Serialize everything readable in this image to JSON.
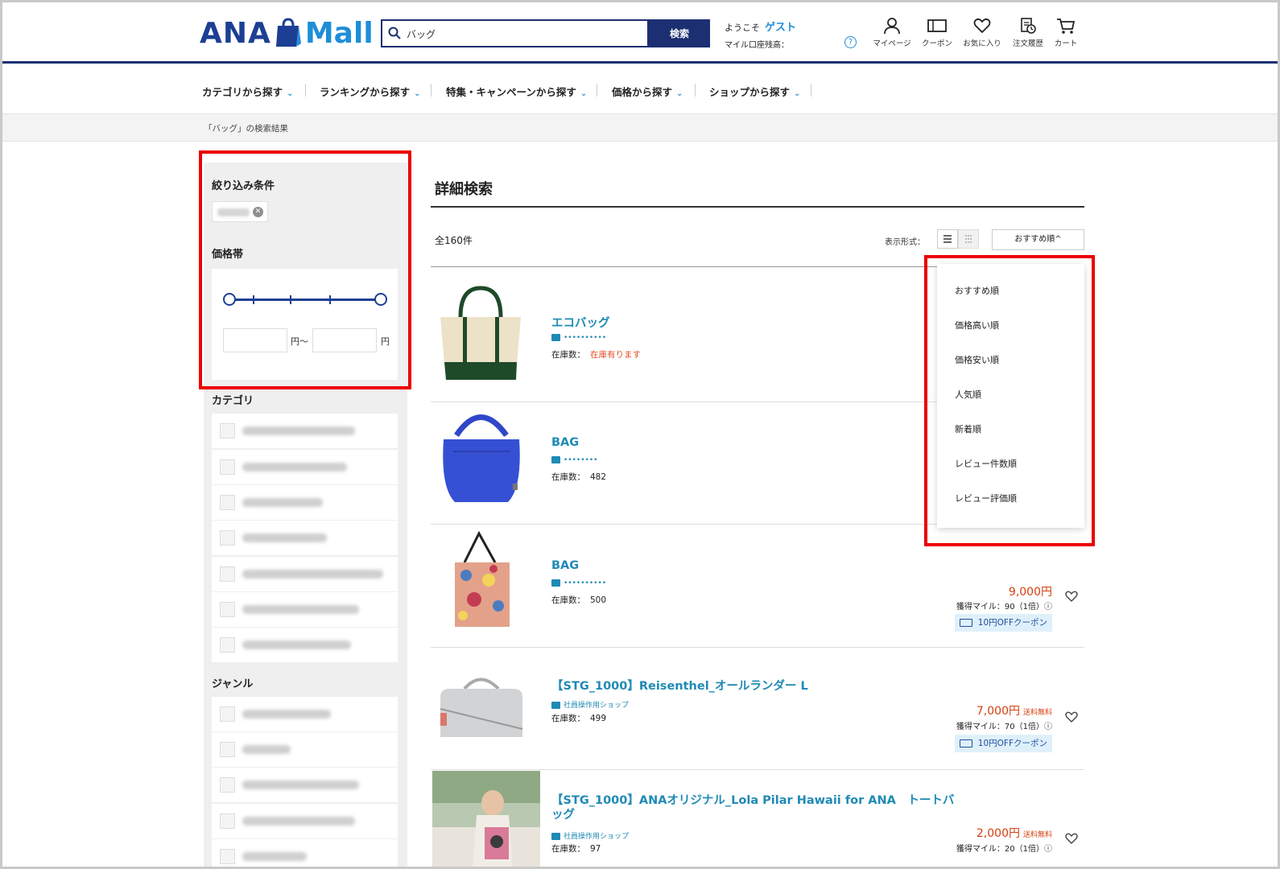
{
  "header": {
    "logo_left": "ANA",
    "logo_right": "Mall",
    "search": {
      "value": "バッグ",
      "button": "検索"
    },
    "welcome": {
      "prefix": "ようこそ",
      "user": "ゲスト"
    },
    "miles_balance_label": "マイル口座残高：",
    "nav": [
      {
        "label": "マイページ",
        "icon": "person-icon"
      },
      {
        "label": "クーポン",
        "icon": "ticket-icon"
      },
      {
        "label": "お気に入り",
        "icon": "heart-icon"
      },
      {
        "label": "注文履歴",
        "icon": "order-history-icon"
      },
      {
        "label": "カート",
        "icon": "cart-icon"
      }
    ]
  },
  "category_nav": [
    {
      "label": "カテゴリから探す"
    },
    {
      "label": "ランキングから探す"
    },
    {
      "label": "特集・キャンペーンから探す"
    },
    {
      "label": "価格から探す"
    },
    {
      "label": "ショップから探す"
    }
  ],
  "breadcrumb": "「バッグ」の検索結果",
  "sidebar": {
    "filter_title": "絞り込み条件",
    "price_title": "価格帯",
    "yen_from": "円〜",
    "yen_to": "円",
    "category_title": "カテゴリ",
    "genre_title": "ジャンル"
  },
  "main": {
    "title": "詳細検索",
    "count": "全160件",
    "display_label": "表示形式：",
    "sort_selected": "おすすめ順^"
  },
  "sort_options": [
    "おすすめ順",
    "価格高い順",
    "価格安い順",
    "人気順",
    "新着順",
    "レビュー件数順",
    "レビュー評価順"
  ],
  "items": [
    {
      "name": "エコバッグ",
      "shop": "••••••••••",
      "stock_label": "在庫数：",
      "stock": "在庫有ります",
      "stock_color": "#e0502a"
    },
    {
      "name": "BAG",
      "shop": "••••••••",
      "stock_label": "在庫数：",
      "stock": "482"
    },
    {
      "name": "BAG",
      "shop": "••••••••••",
      "stock_label": "在庫数：",
      "stock": "500",
      "price": "9,000円",
      "miles": "獲得マイル：90（1倍）ⓘ",
      "coupon": "10円OFFクーポン"
    },
    {
      "name": "【STG_1000】Reisenthel_オールランダー L",
      "shop": "社員操作用ショップ",
      "stock_label": "在庫数：",
      "stock": "499",
      "price": "7,000円",
      "free": "送料無料",
      "miles": "獲得マイル：70（1倍）ⓘ",
      "coupon": "10円OFFクーポン"
    },
    {
      "name_line1": "【STG_1000】ANAオリジナル_Lola Pilar Hawaii for ANA　トートバ",
      "name_line2": "ッグ",
      "shop": "社員操作用ショップ",
      "stock_label": "在庫数：",
      "stock": "97",
      "price": "2,000円",
      "free": "送料無料",
      "miles": "獲得マイル：20（1倍）ⓘ"
    }
  ],
  "colors": {
    "brand_navy": "#1c2f72",
    "link_blue": "#1f8ab5",
    "price_red": "#d4400f",
    "highlight": "#ec0000"
  }
}
